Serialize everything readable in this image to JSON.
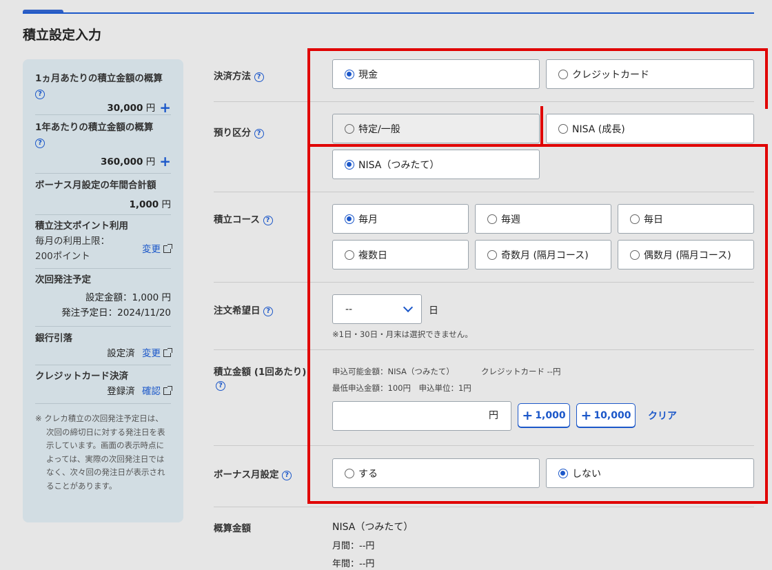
{
  "page": {
    "title": "積立設定入力"
  },
  "sidebar": {
    "monthly_label": "1ヵ月あたりの積立金額の概算",
    "monthly_amount": "30,000",
    "yearly_label": "1年あたりの積立金額の概算",
    "yearly_amount": "360,000",
    "bonus_label": "ボーナス月設定の年間合計額",
    "bonus_amount": "1,000",
    "yen": "円",
    "points_label": "積立注文ポイント利用",
    "points_limit_line1": "毎月の利用上限：",
    "points_limit_line2": "200ポイント",
    "change_link": "変更",
    "next_order_label": "次回発注予定",
    "next_amount_text": "設定金額：1,000 円",
    "next_date_text": "発注予定日：2024/11/20",
    "bank_label": "銀行引落",
    "bank_status": "設定済",
    "credit_label": "クレジットカード決済",
    "credit_status": "登録済",
    "confirm_link": "確認",
    "note": "※ クレカ積立の次回発注予定日は、次回の締切日に対する発注日を表示しています。画面の表示時点によっては、実際の次回発注日ではなく、次々回の発注日が表示されることがあります。"
  },
  "form": {
    "payment": {
      "label": "決済方法",
      "options": [
        "現金",
        "クレジットカード"
      ],
      "selected": "現金"
    },
    "account": {
      "label": "預り区分",
      "options": [
        "特定/一般",
        "NISA (成長)",
        "NISA（つみたて）"
      ],
      "selected": "NISA（つみたて）"
    },
    "course": {
      "label": "積立コース",
      "options": [
        "毎月",
        "毎週",
        "毎日",
        "複数日",
        "奇数月 (隔月コース)",
        "偶数月 (隔月コース)"
      ],
      "selected": "毎月"
    },
    "order_day": {
      "label": "注文希望日",
      "value": "--",
      "suffix": "日",
      "note": "※1日・30日・月末は選択できません。"
    },
    "amount": {
      "label": "積立金額 (1回あたり)",
      "available_text": "申込可能金額：NISA（つみたて）",
      "credit_text": "クレジットカード --円",
      "min_text": "最低申込金額：100円　申込単位：1円",
      "unit": "円",
      "add1": "1,000",
      "add2": "10,000",
      "clear": "クリア"
    },
    "bonus": {
      "label": "ボーナス月設定",
      "options": [
        "する",
        "しない"
      ],
      "selected": "しない"
    },
    "estimate": {
      "label": "概算金額",
      "account": "NISA（つみたて）",
      "monthly": "月間：--円",
      "yearly": "年間：--円"
    }
  },
  "colors": {
    "accent": "#1b57c9",
    "highlight": "#e00000",
    "sidebar_bg": "#d2dde3"
  }
}
